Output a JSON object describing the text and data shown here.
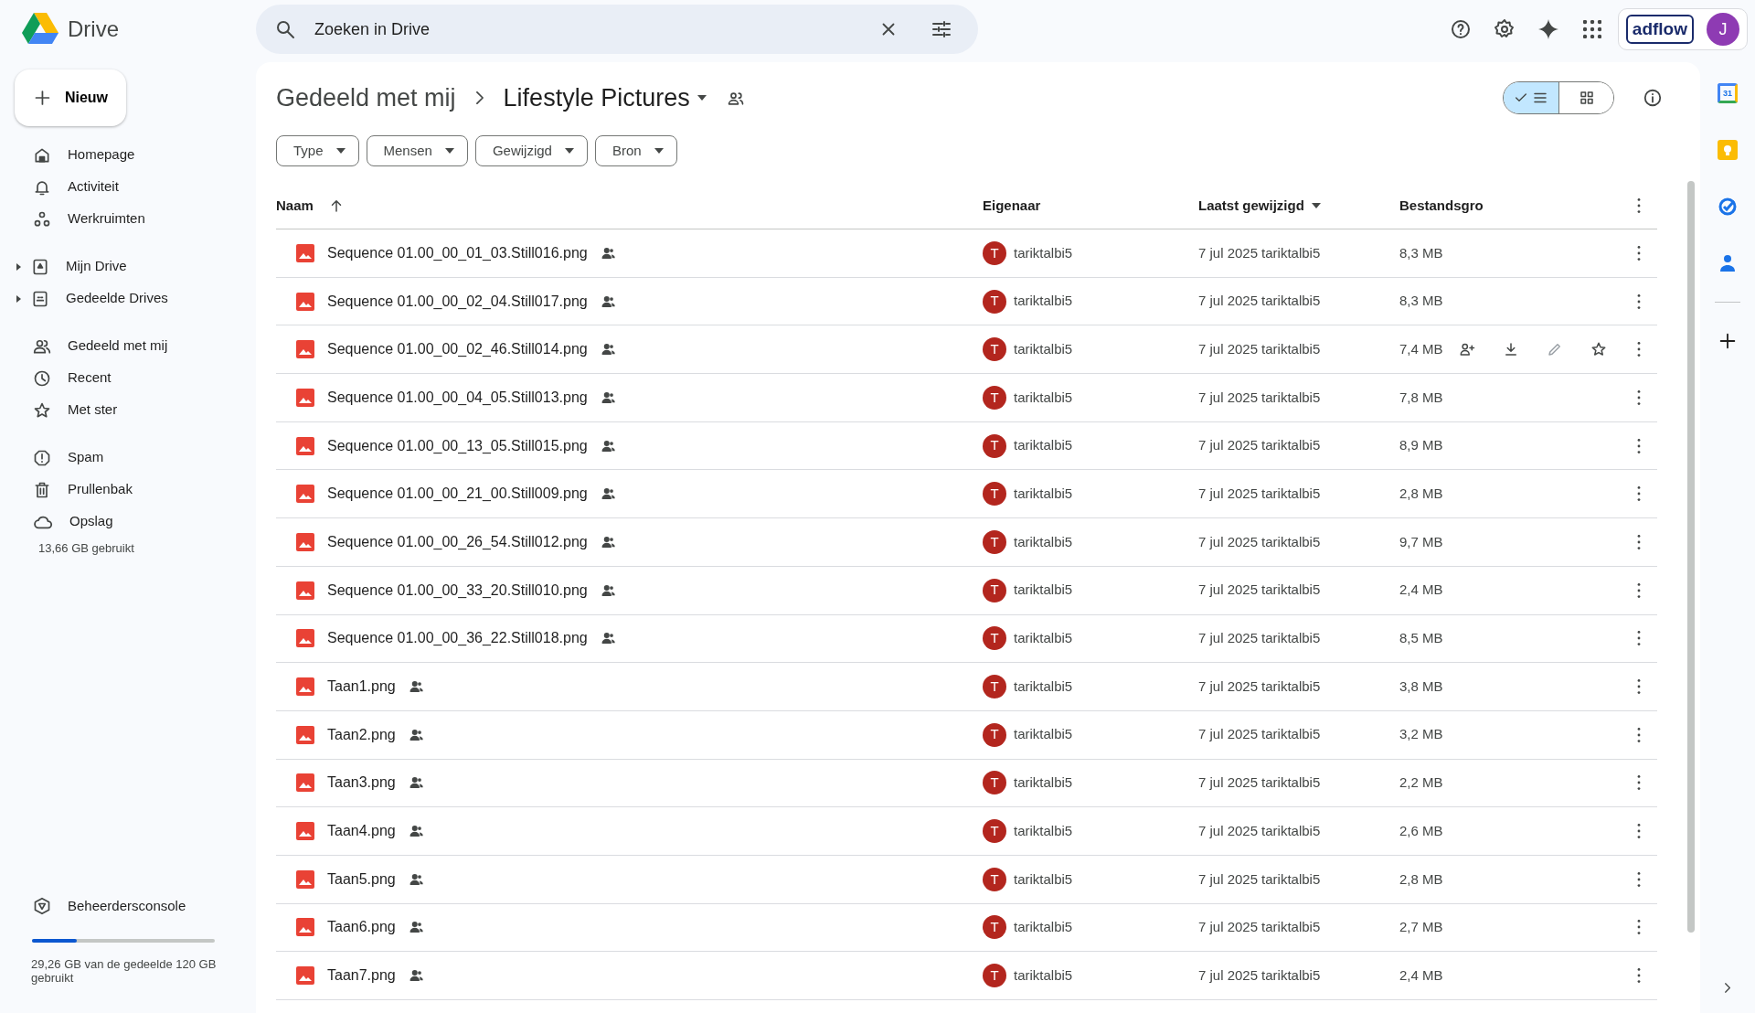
{
  "app": {
    "name": "Drive"
  },
  "search": {
    "placeholder": "Zoeken in Drive"
  },
  "account": {
    "brand": "adflow",
    "initial": "J"
  },
  "new_button": {
    "label": "Nieuw"
  },
  "sidebar": {
    "sections": [
      [
        {
          "label": "Homepage",
          "expandable": false,
          "selected": false
        },
        {
          "label": "Activiteit",
          "expandable": false,
          "selected": false
        },
        {
          "label": "Werkruimten",
          "expandable": false,
          "selected": false
        }
      ],
      [
        {
          "label": "Mijn Drive",
          "expandable": true,
          "selected": false
        },
        {
          "label": "Gedeelde Drives",
          "expandable": true,
          "selected": false
        }
      ],
      [
        {
          "label": "Gedeeld met mij",
          "expandable": false,
          "selected": false
        },
        {
          "label": "Recent",
          "expandable": false,
          "selected": false
        },
        {
          "label": "Met ster",
          "expandable": false,
          "selected": false
        }
      ],
      [
        {
          "label": "Spam",
          "expandable": false,
          "selected": false
        },
        {
          "label": "Prullenbak",
          "expandable": false,
          "selected": false
        },
        {
          "label": "Opslag",
          "expandable": false,
          "selected": false
        }
      ]
    ],
    "storage_used": "13,66 GB gebruikt",
    "admin_console": "Beheerdersconsole",
    "shared_storage": {
      "level": 0.244,
      "text": "29,26 GB van de gedeelde 120 GB gebruikt"
    }
  },
  "breadcrumb": [
    "Gedeeld met mij",
    "Lifestyle Pictures"
  ],
  "view_toggle": [
    {
      "kind": "list",
      "selected": true
    },
    {
      "kind": "grid",
      "selected": false
    }
  ],
  "filters": [
    "Type",
    "Mensen",
    "Gewijzigd",
    "Bron"
  ],
  "table": {
    "columns": [
      "Naam",
      "Eigenaar",
      "Laatst gewijzigd",
      "Bestandsgro"
    ],
    "rows": [
      {
        "name": "Sequence 01.00_00_01_03.Still016.png",
        "owner_initial": "T",
        "owner": "tariktalbi5",
        "modified": "7 jul 2025",
        "modified_by": "tariktalbi5",
        "size": "8,3 MB",
        "hovered": false
      },
      {
        "name": "Sequence 01.00_00_02_04.Still017.png",
        "owner_initial": "T",
        "owner": "tariktalbi5",
        "modified": "7 jul 2025",
        "modified_by": "tariktalbi5",
        "size": "8,3 MB",
        "hovered": false
      },
      {
        "name": "Sequence 01.00_00_02_46.Still014.png",
        "owner_initial": "T",
        "owner": "tariktalbi5",
        "modified": "7 jul 2025",
        "modified_by": "tariktalbi5",
        "size": "7,4 MB",
        "hovered": true
      },
      {
        "name": "Sequence 01.00_00_04_05.Still013.png",
        "owner_initial": "T",
        "owner": "tariktalbi5",
        "modified": "7 jul 2025",
        "modified_by": "tariktalbi5",
        "size": "7,8 MB",
        "hovered": false
      },
      {
        "name": "Sequence 01.00_00_13_05.Still015.png",
        "owner_initial": "T",
        "owner": "tariktalbi5",
        "modified": "7 jul 2025",
        "modified_by": "tariktalbi5",
        "size": "8,9 MB",
        "hovered": false
      },
      {
        "name": "Sequence 01.00_00_21_00.Still009.png",
        "owner_initial": "T",
        "owner": "tariktalbi5",
        "modified": "7 jul 2025",
        "modified_by": "tariktalbi5",
        "size": "2,8 MB",
        "hovered": false
      },
      {
        "name": "Sequence 01.00_00_26_54.Still012.png",
        "owner_initial": "T",
        "owner": "tariktalbi5",
        "modified": "7 jul 2025",
        "modified_by": "tariktalbi5",
        "size": "9,7 MB",
        "hovered": false
      },
      {
        "name": "Sequence 01.00_00_33_20.Still010.png",
        "owner_initial": "T",
        "owner": "tariktalbi5",
        "modified": "7 jul 2025",
        "modified_by": "tariktalbi5",
        "size": "2,4 MB",
        "hovered": false
      },
      {
        "name": "Sequence 01.00_00_36_22.Still018.png",
        "owner_initial": "T",
        "owner": "tariktalbi5",
        "modified": "7 jul 2025",
        "modified_by": "tariktalbi5",
        "size": "8,5 MB",
        "hovered": false
      },
      {
        "name": "Taan1.png",
        "owner_initial": "T",
        "owner": "tariktalbi5",
        "modified": "7 jul 2025",
        "modified_by": "tariktalbi5",
        "size": "3,8 MB",
        "hovered": false
      },
      {
        "name": "Taan2.png",
        "owner_initial": "T",
        "owner": "tariktalbi5",
        "modified": "7 jul 2025",
        "modified_by": "tariktalbi5",
        "size": "3,2 MB",
        "hovered": false
      },
      {
        "name": "Taan3.png",
        "owner_initial": "T",
        "owner": "tariktalbi5",
        "modified": "7 jul 2025",
        "modified_by": "tariktalbi5",
        "size": "2,2 MB",
        "hovered": false
      },
      {
        "name": "Taan4.png",
        "owner_initial": "T",
        "owner": "tariktalbi5",
        "modified": "7 jul 2025",
        "modified_by": "tariktalbi5",
        "size": "2,6 MB",
        "hovered": false
      },
      {
        "name": "Taan5.png",
        "owner_initial": "T",
        "owner": "tariktalbi5",
        "modified": "7 jul 2025",
        "modified_by": "tariktalbi5",
        "size": "2,8 MB",
        "hovered": false
      },
      {
        "name": "Taan6.png",
        "owner_initial": "T",
        "owner": "tariktalbi5",
        "modified": "7 jul 2025",
        "modified_by": "tariktalbi5",
        "size": "2,7 MB",
        "hovered": false
      },
      {
        "name": "Taan7.png",
        "owner_initial": "T",
        "owner": "tariktalbi5",
        "modified": "7 jul 2025",
        "modified_by": "tariktalbi5",
        "size": "2,4 MB",
        "hovered": false
      }
    ]
  },
  "side_panel": {
    "calendar_day": "31"
  }
}
